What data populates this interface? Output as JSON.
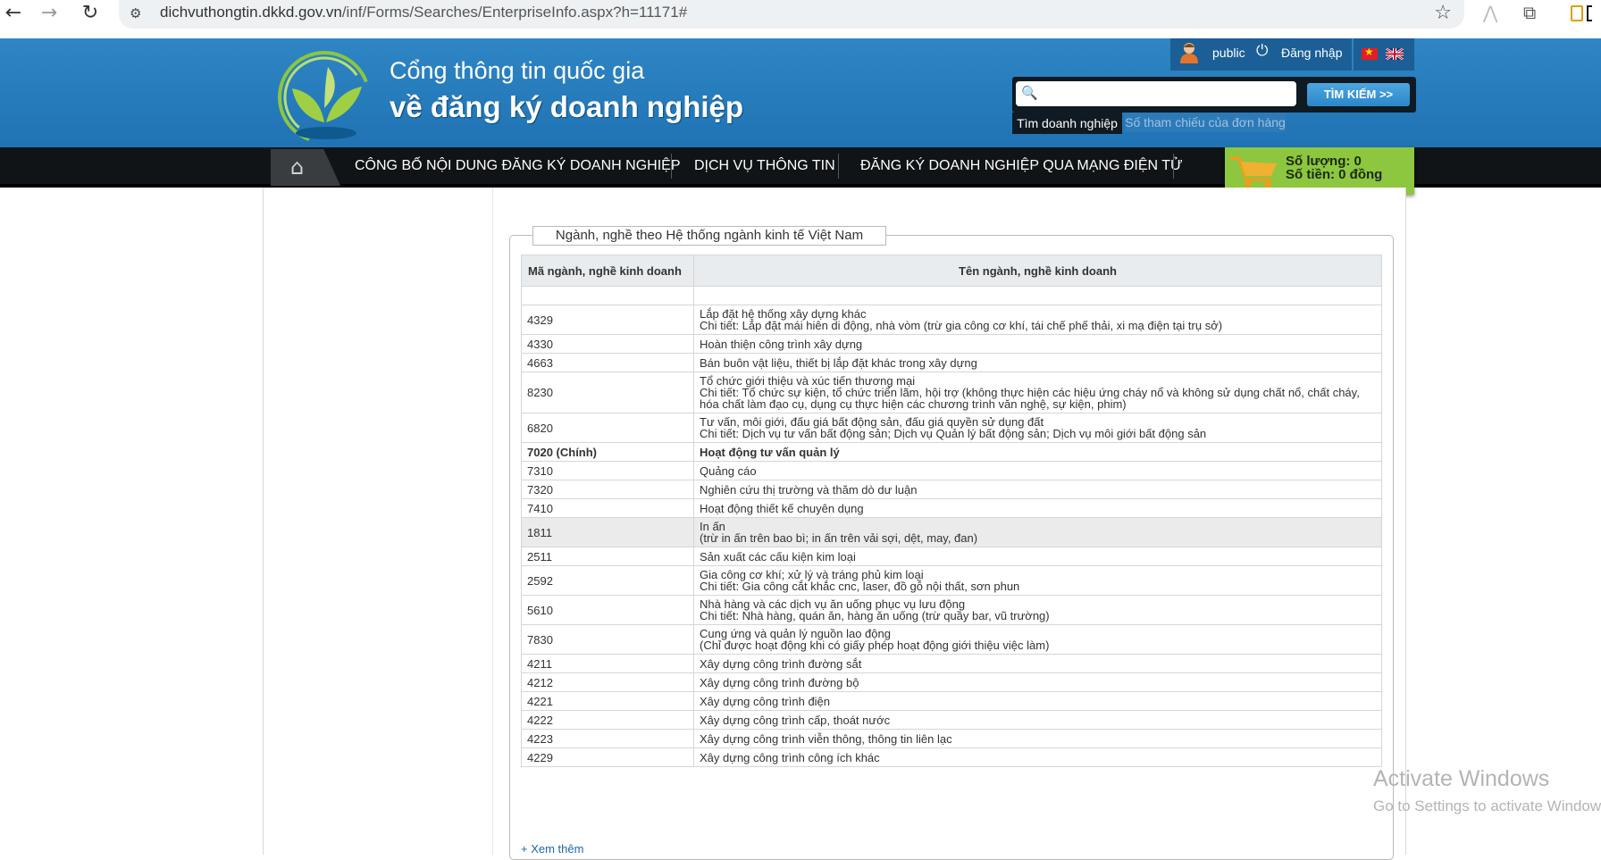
{
  "browser": {
    "url_host": "dichvuthongtin.dkkd.gov.vn",
    "url_path": "/inf/Forms/Searches/EnterpriseInfo.aspx?h=11171#",
    "back_icon": "←",
    "forward_icon": "→",
    "reload_icon": "↻",
    "site_info_icon": "⚙",
    "star_icon": "☆",
    "ext_icon_1": "⋀",
    "ext_icon_2": "⧉"
  },
  "header": {
    "title_line1": "Cổng thông tin quốc gia",
    "title_line2": "về đăng ký doanh nghiệp",
    "user": "public",
    "login": "Đăng nhập",
    "power_icon": "⏻",
    "flag_vn_star": "★"
  },
  "search": {
    "placeholder": "",
    "button": "TÌM KIẾM >>",
    "tab_active": "Tìm doanh nghiệp",
    "tab_other": "Số tham chiếu của đơn hàng",
    "search_icon": "🔍"
  },
  "nav": {
    "home_icon": "⌂",
    "items": [
      "CÔNG BỐ NỘI DUNG ĐĂNG KÝ DOANH NGHIỆP",
      "DỊCH VỤ THÔNG TIN",
      "ĐĂNG KÝ DOANH NGHIỆP QUA MẠNG ĐIỆN TỬ"
    ]
  },
  "cart": {
    "quantity": "Số lượng: 0",
    "amount": "Số tiền: 0 đồng"
  },
  "section": {
    "legend": "Ngành, nghề theo Hệ thống ngành kinh tế Việt Nam",
    "col_code": "Mã ngành, nghề kinh doanh",
    "col_name": "Tên ngành, nghề kinh doanh",
    "see_more": "+ Xem thêm",
    "rows": [
      {
        "code": "",
        "lines": [
          ""
        ]
      },
      {
        "code": "4329",
        "lines": [
          "Lắp đặt hệ thống xây dựng khác",
          "Chi tiết: Lắp đặt mái hiên di động, nhà vòm (trừ gia công cơ khí, tái chế phế thải, xi mạ điện tại trụ sở)"
        ]
      },
      {
        "code": "4330",
        "lines": [
          "Hoàn thiện công trình xây dựng"
        ]
      },
      {
        "code": "4663",
        "lines": [
          "Bán buôn vật liệu, thiết bị lắp đặt khác trong xây dựng"
        ]
      },
      {
        "code": "8230",
        "lines": [
          "Tổ chức giới thiệu và xúc tiến thương mại",
          "Chi tiết: Tổ chức sự kiện, tổ chức triển lãm, hội trợ (không thực hiện các hiệu ứng cháy nổ và không sử dụng chất nổ, chất cháy,",
          "hóa chất làm đạo cụ, dụng cụ thực hiện các chương trình văn nghệ, sự kiện, phim)"
        ]
      },
      {
        "code": "6820",
        "lines": [
          "Tư vấn, môi giới, đấu giá bất động sản, đấu giá quyền sử dụng đất",
          "Chi tiết: Dịch vụ tư vấn bất động sản; Dịch vụ Quản lý bất động sản; Dịch vụ môi giới bất động sản"
        ]
      },
      {
        "code": "7020 (Chính)",
        "lines": [
          "Hoạt động tư vấn quản lý"
        ],
        "main": true
      },
      {
        "code": "7310",
        "lines": [
          "Quảng cáo"
        ]
      },
      {
        "code": "7320",
        "lines": [
          "Nghiên cứu thị trường và thăm dò dư luận"
        ]
      },
      {
        "code": "7410",
        "lines": [
          "Hoạt động thiết kế chuyên dụng"
        ]
      },
      {
        "code": "1811",
        "lines": [
          "In ấn",
          "(trừ in ấn trên bao bì; in ấn trên vải sợi, dệt, may, đan)"
        ],
        "highlight": true
      },
      {
        "code": "2511",
        "lines": [
          "Sản xuất các cấu kiện kim loại"
        ]
      },
      {
        "code": "2592",
        "lines": [
          "Gia công cơ khí; xử lý và tráng phủ kim loại",
          "Chi tiết: Gia công cắt khắc cnc, laser, đồ gỗ nội thất, sơn phun"
        ]
      },
      {
        "code": "5610",
        "lines": [
          "Nhà hàng và các dịch vụ ăn uống phục vụ lưu động",
          "Chi tiết: Nhà hàng, quán ăn, hàng ăn uống (trừ quầy bar, vũ trường)"
        ]
      },
      {
        "code": "7830",
        "lines": [
          "Cung ứng và quản lý nguồn lao động",
          "(Chỉ được hoạt động khi có giấy phép hoạt động giới thiệu việc làm)"
        ]
      },
      {
        "code": "4211",
        "lines": [
          "Xây dựng công trình đường sắt"
        ]
      },
      {
        "code": "4212",
        "lines": [
          "Xây dựng công trình đường bộ"
        ]
      },
      {
        "code": "4221",
        "lines": [
          "Xây dựng công trình điện"
        ]
      },
      {
        "code": "4222",
        "lines": [
          "Xây dựng công trình cấp, thoát nước"
        ]
      },
      {
        "code": "4223",
        "lines": [
          "Xây dựng công trình viễn thông, thông tin liên lạc"
        ]
      },
      {
        "code": "4229",
        "lines": [
          "Xây dựng công trình công ích khác"
        ]
      }
    ]
  },
  "watermark": {
    "line1": "Activate Windows",
    "line2": "Go to Settings to activate Windows."
  }
}
